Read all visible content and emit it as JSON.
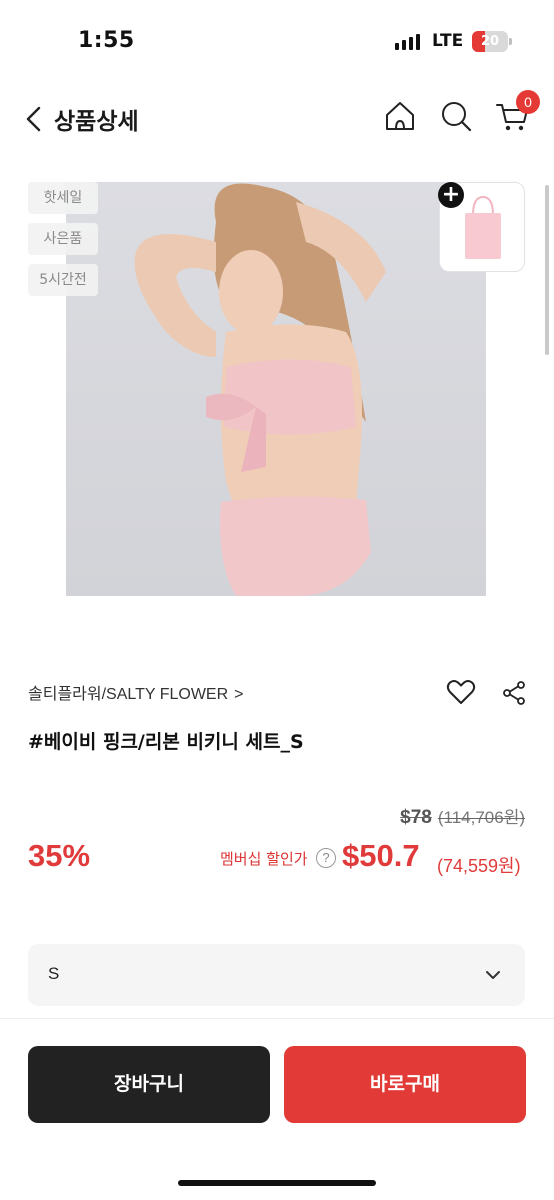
{
  "status_bar": {
    "time": "1:55",
    "network": "LTE",
    "battery_level": "20",
    "battery_fraction": 0.2,
    "battery_color": "#e53935"
  },
  "header": {
    "title": "상품상세",
    "cart_count": "0",
    "back_icon": "chevron-left-icon",
    "home_icon": "home-icon",
    "search_icon": "search-icon",
    "cart_icon": "cart-icon"
  },
  "badges": [
    "핫세일",
    "사은품",
    "5시간전"
  ],
  "gift": {
    "icon": "tote-bag-icon",
    "plus_label": "+"
  },
  "product": {
    "brand": "솔티플라워/SALTY FLOWER",
    "brand_chevron": ">",
    "name": "#베이비 핑크/리본 비키니 세트_S"
  },
  "price": {
    "original_usd": "$78",
    "original_krw": "(114,706원)",
    "discount": "35%",
    "member_label": "멤버십 할인가",
    "help_label": "?",
    "sale_usd": "$50.7",
    "sale_krw": "(74,559원)",
    "accent_color": "#e03a3a"
  },
  "option": {
    "selected": "S"
  },
  "actions": {
    "cart_label": "장바구니",
    "buy_label": "바로구매"
  }
}
